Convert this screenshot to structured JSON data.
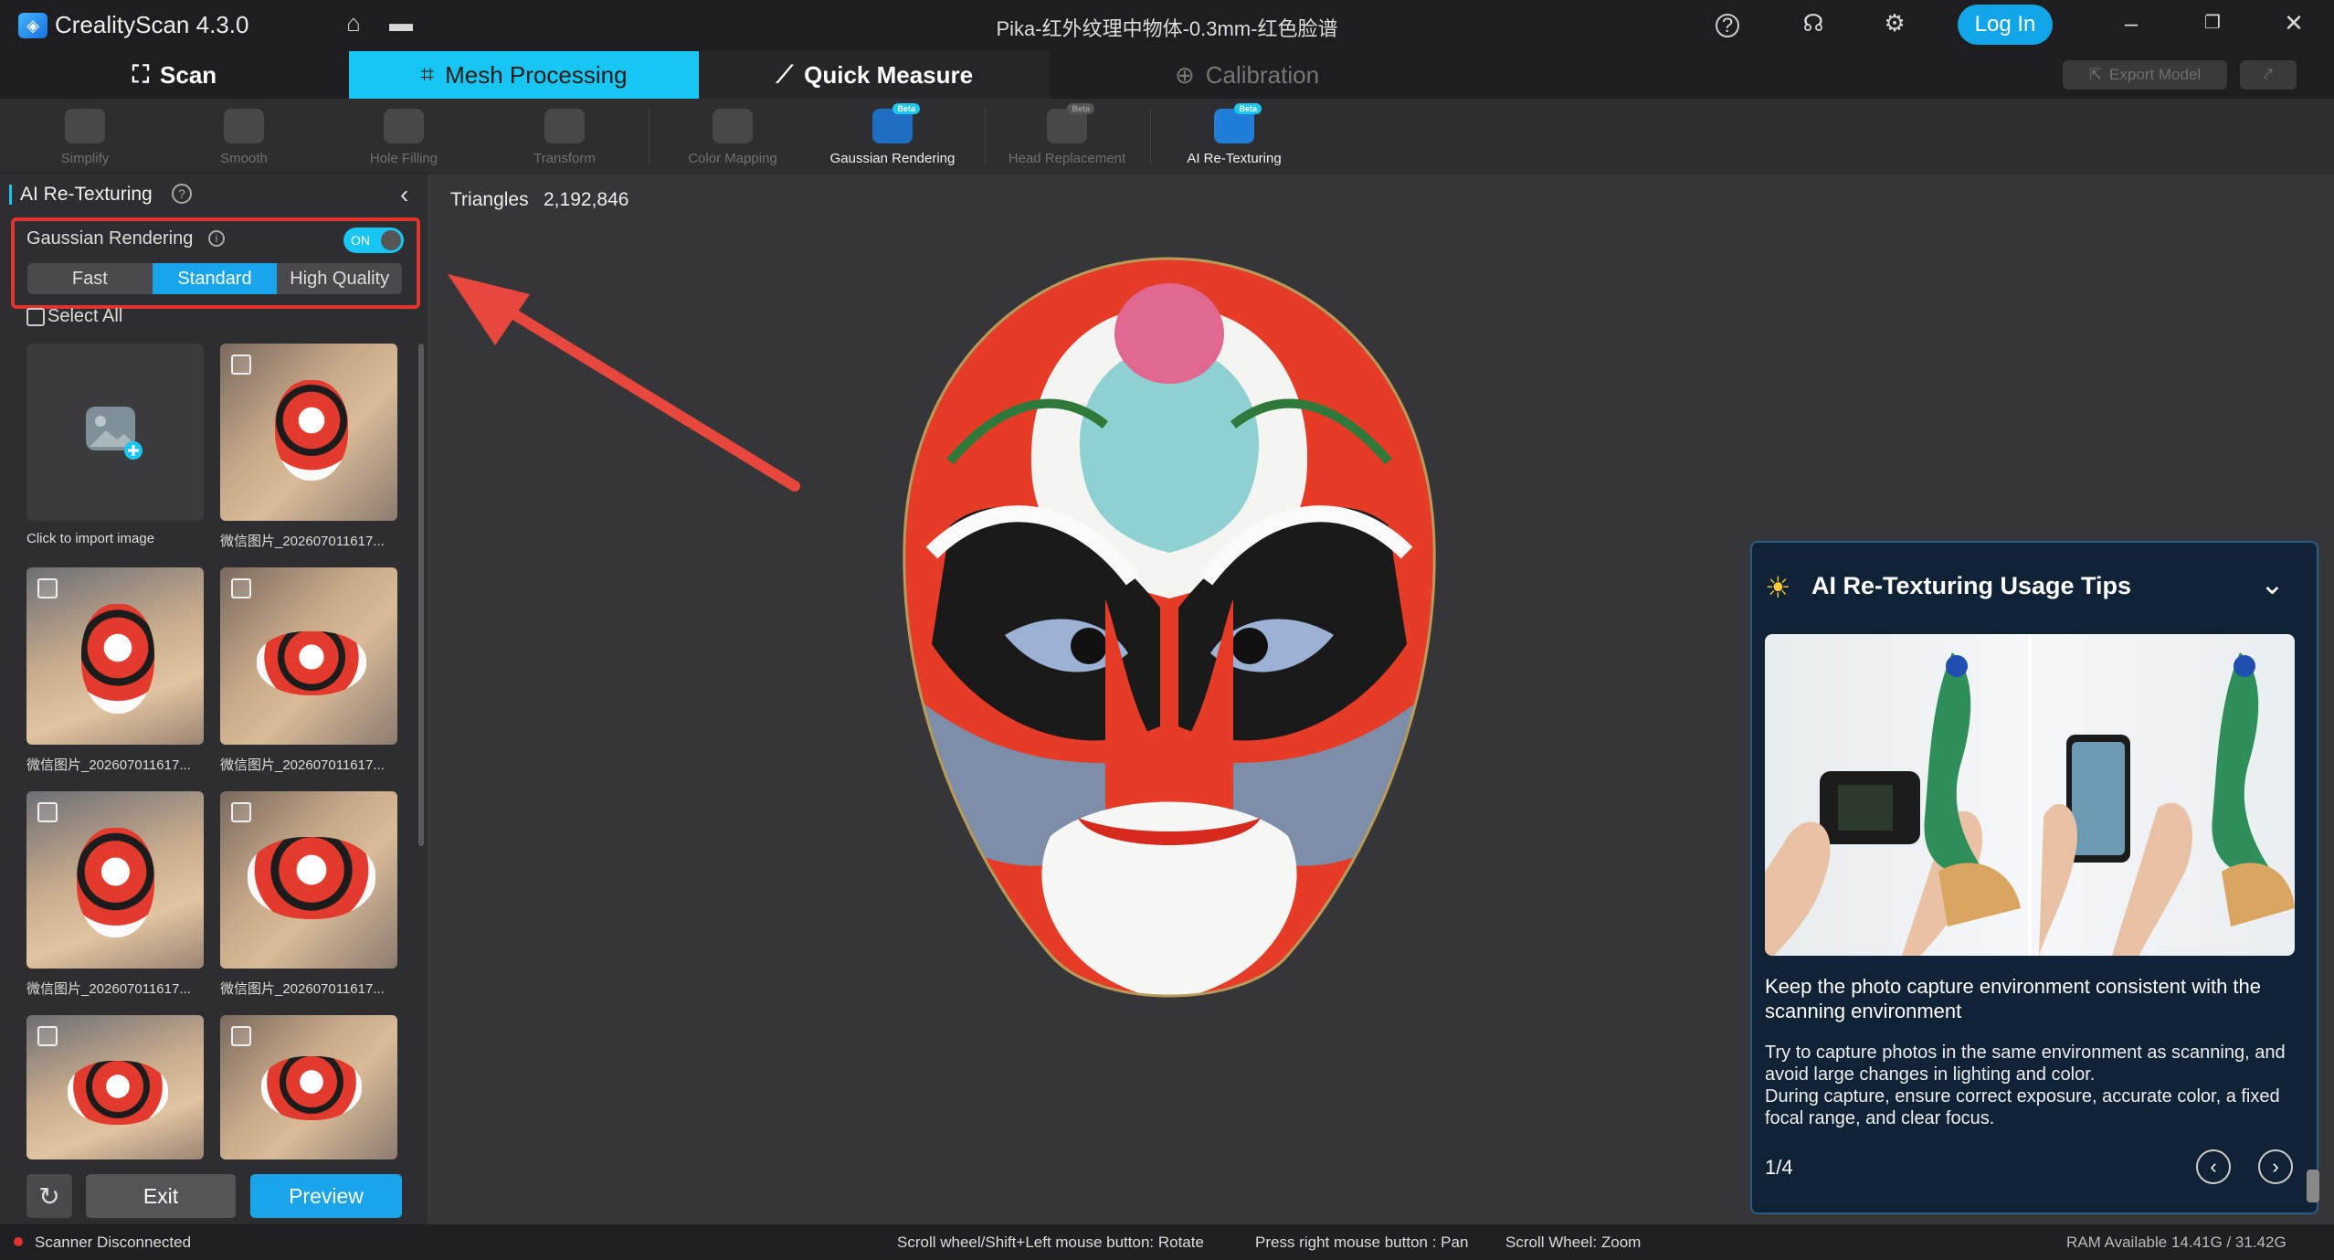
{
  "app": {
    "name": "CrealityScan 4.3.0",
    "window_title": "Pika-红外纹理中物体-0.3mm-红色脸谱",
    "login_label": "Log In"
  },
  "main_tabs": [
    {
      "label": "Scan",
      "icon": "scan-frame-icon"
    },
    {
      "label": "Mesh Processing",
      "icon": "mesh-crop-icon",
      "active": true
    },
    {
      "label": "Quick Measure",
      "icon": "ruler-icon"
    },
    {
      "label": "Calibration",
      "icon": "target-icon",
      "disabled": true
    }
  ],
  "top_actions": {
    "export_label": "Export Model"
  },
  "tools": [
    {
      "label": "Simplify",
      "enabled": false
    },
    {
      "label": "Smooth",
      "enabled": false
    },
    {
      "label": "Hole Filling",
      "enabled": false
    },
    {
      "label": "Transform",
      "enabled": false
    },
    {
      "label": "Color Mapping",
      "enabled": false
    },
    {
      "label": "Gaussian Rendering",
      "enabled": true,
      "badge": "Beta"
    },
    {
      "label": "Head Replacement",
      "enabled": false,
      "badge": "Beta"
    },
    {
      "label": "AI Re-Texturing",
      "enabled": true,
      "badge": "Beta",
      "active": true
    }
  ],
  "panel": {
    "title": "AI Re-Texturing",
    "gaussian_label": "Gaussian Rendering",
    "toggle_label": "ON",
    "modes": [
      "Fast",
      "Standard",
      "High Quality"
    ],
    "selected_mode": "Standard",
    "select_all_label": "Select All",
    "import_caption": "Click to import image",
    "thumbs": [
      {
        "caption": "微信图片_202607011617..."
      },
      {
        "caption": "微信图片_202607011617..."
      },
      {
        "caption": "微信图片_202607011617..."
      },
      {
        "caption": "微信图片_202607011617..."
      },
      {
        "caption": "微信图片_202607011617..."
      },
      {
        "caption": ""
      },
      {
        "caption": ""
      }
    ],
    "exit_label": "Exit",
    "preview_label": "Preview"
  },
  "viewport": {
    "triangles_label": "Triangles",
    "triangles_value": "2,192,846"
  },
  "tips": {
    "title": "AI Re-Texturing Usage Tips",
    "heading": "Keep the photo capture environment consistent with the scanning environment",
    "body": "Try to capture photos in the same environment as scanning, and avoid large changes in lighting and color.\nDuring capture, ensure correct exposure, accurate color, a fixed focal range, and clear focus.",
    "page": "1/4"
  },
  "status": {
    "scanner": "Scanner Disconnected",
    "hint_rotate": "Scroll wheel/Shift+Left mouse button: Rotate",
    "hint_pan": "Press right mouse button : Pan",
    "hint_zoom": "Scroll Wheel: Zoom",
    "ram": "RAM Available 14.41G / 31.42G"
  },
  "colors": {
    "accent": "#17c6f2",
    "highlight_box": "#e3342b",
    "arrow": "#e8473d"
  }
}
